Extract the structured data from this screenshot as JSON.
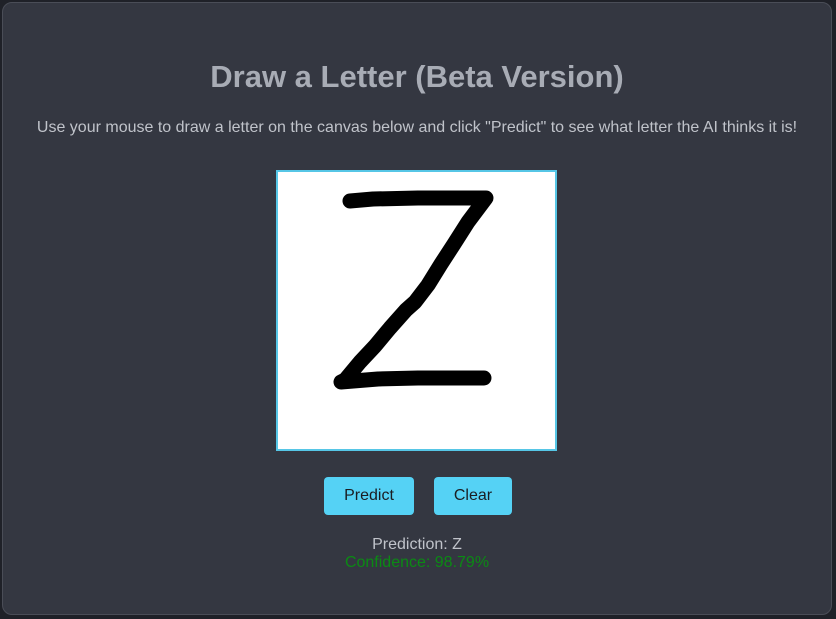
{
  "page": {
    "title": "Draw a Letter (Beta Version)",
    "instructions": "Use your mouse to draw a letter on the canvas below and click \"Predict\" to see what letter the AI thinks it is!"
  },
  "canvas": {
    "drawn_letter": "Z",
    "border_color": "#56c6e6",
    "stroke_color": "#000000"
  },
  "buttons": {
    "predict_label": "Predict",
    "clear_label": "Clear",
    "color": "#55d2f5"
  },
  "result": {
    "prediction_text": "Prediction: Z",
    "confidence_text": "Confidence: 98.79%",
    "confidence_color": "#0b8a14"
  }
}
